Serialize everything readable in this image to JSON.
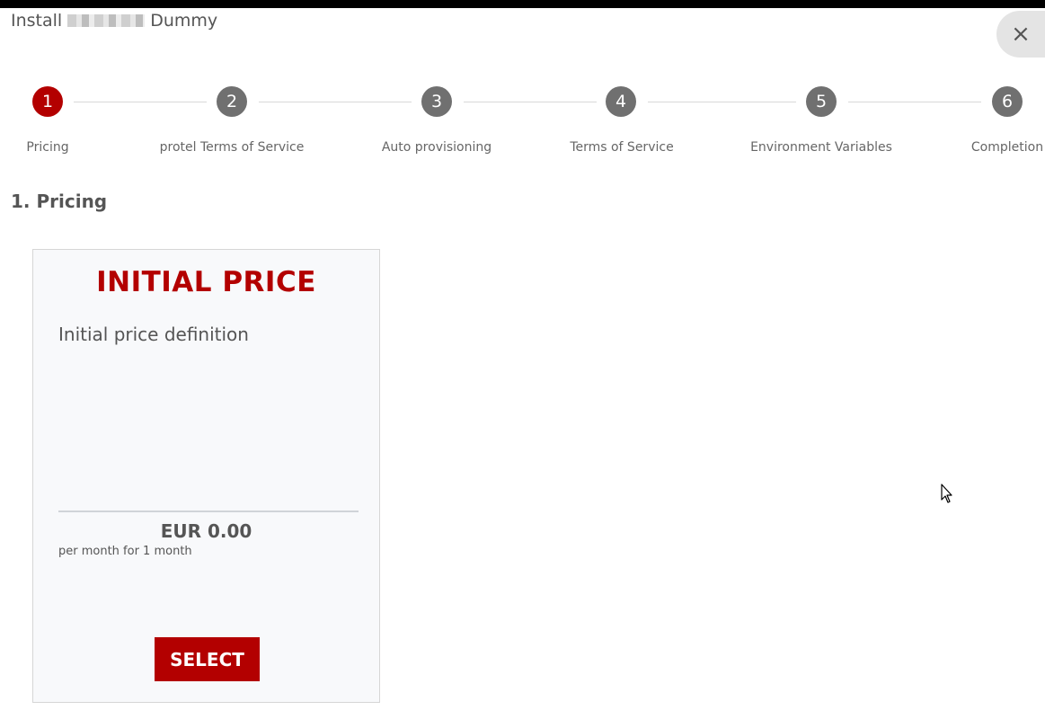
{
  "dialog": {
    "title_prefix": "Install",
    "title_suffix": "Dummy",
    "close_icon": "×"
  },
  "stepper": {
    "active_step": 1,
    "steps": [
      {
        "number": "1",
        "label": "Pricing"
      },
      {
        "number": "2",
        "label": "protel Terms of Service"
      },
      {
        "number": "3",
        "label": "Auto provisioning"
      },
      {
        "number": "4",
        "label": "Terms of Service"
      },
      {
        "number": "5",
        "label": "Environment Variables"
      },
      {
        "number": "6",
        "label": "Completion"
      }
    ]
  },
  "section": {
    "title": "1. Pricing"
  },
  "pricing_card": {
    "title": "INITIAL PRICE",
    "description": "Initial price definition",
    "price": "EUR 0.00",
    "period": "per month for 1 month",
    "select_label": "SELECT"
  },
  "colors": {
    "accent": "#b30000",
    "step_inactive": "#707070",
    "card_bg": "#f8f9fb"
  }
}
